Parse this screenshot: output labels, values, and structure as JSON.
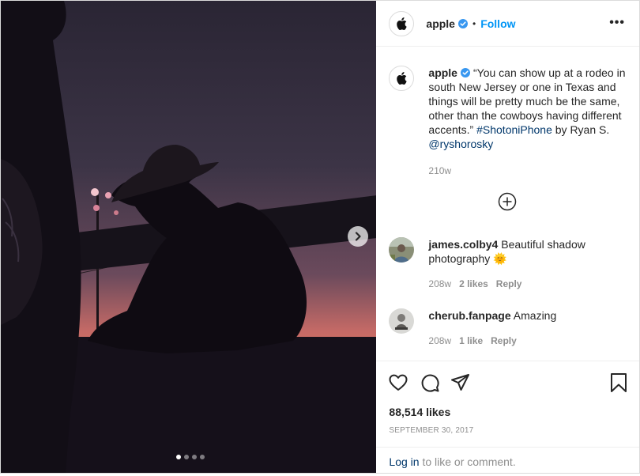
{
  "post": {
    "username": "apple",
    "follow_label": "Follow",
    "separator": "•",
    "more_label": "•••"
  },
  "caption": {
    "username": "apple",
    "text_1": "“You can show up at a rodeo in south New Jersey or one in Texas and things will be pretty much be the same, other than the cowboys having different accents.” ",
    "hashtag": "#ShotoniPhone",
    "text_2": " by Ryan S. ",
    "mention": "@ryshorosky",
    "time": "210w"
  },
  "comments": [
    {
      "username": "james.colby4",
      "text": "Beautiful shadow photography ",
      "emoji": "🌞",
      "time": "208w",
      "likes": "2 likes",
      "reply": "Reply"
    },
    {
      "username": "cherub.fanpage",
      "text": "Amazing",
      "time": "208w",
      "likes": "1 like",
      "reply": "Reply"
    }
  ],
  "stats": {
    "likes": "88,514 likes",
    "date": "SEPTEMBER 30, 2017"
  },
  "login": {
    "link": "Log in",
    "rest": " to like or comment."
  },
  "carousel": {
    "count": 4,
    "active_index": 0
  },
  "colors": {
    "accent": "#0095f6",
    "link": "#00376b",
    "muted": "#8e8e8e",
    "verified": "#3897f0"
  }
}
